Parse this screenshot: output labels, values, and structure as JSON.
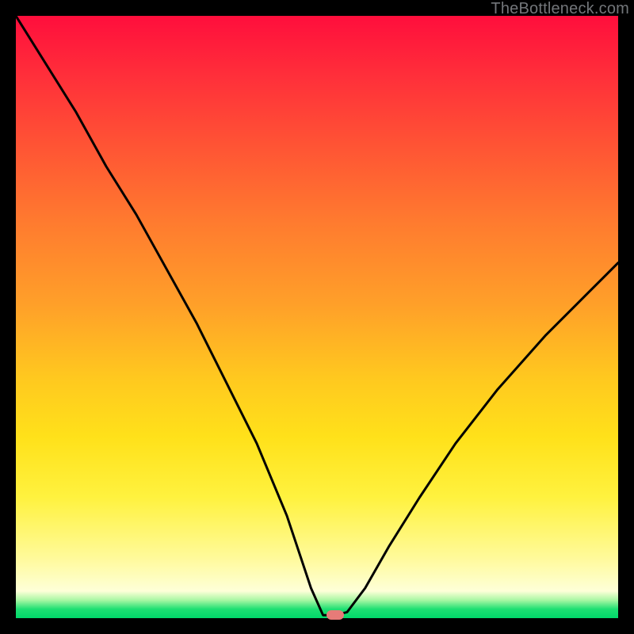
{
  "watermark": "TheBottleneck.com",
  "chart_data": {
    "type": "line",
    "title": "",
    "xlabel": "",
    "ylabel": "",
    "xlim": [
      0,
      1
    ],
    "ylim": [
      0,
      1
    ],
    "grid": false,
    "legend": false,
    "series": [
      {
        "name": "bottleneck-curve",
        "color": "#000000",
        "x": [
          0.0,
          0.05,
          0.1,
          0.15,
          0.2,
          0.25,
          0.3,
          0.35,
          0.4,
          0.45,
          0.49,
          0.51,
          0.53,
          0.55,
          0.58,
          0.62,
          0.67,
          0.73,
          0.8,
          0.88,
          0.95,
          1.0
        ],
        "values": [
          1.0,
          0.92,
          0.84,
          0.75,
          0.67,
          0.58,
          0.49,
          0.39,
          0.29,
          0.17,
          0.05,
          0.005,
          0.005,
          0.01,
          0.05,
          0.12,
          0.2,
          0.29,
          0.38,
          0.47,
          0.54,
          0.59
        ]
      }
    ],
    "annotations": [
      {
        "name": "minimum-marker",
        "x": 0.53,
        "y": 0.005,
        "color": "#e77b78"
      }
    ]
  }
}
